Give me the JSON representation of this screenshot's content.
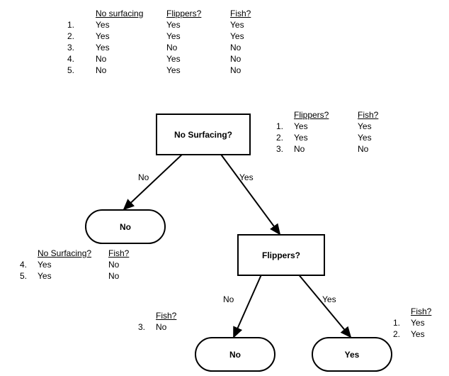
{
  "main_table": {
    "headers": [
      "",
      "No surfacing",
      "Flippers?",
      "Fish?"
    ],
    "rows": [
      [
        "1.",
        "Yes",
        "Yes",
        "Yes"
      ],
      [
        "2.",
        "Yes",
        "Yes",
        "Yes"
      ],
      [
        "3.",
        "Yes",
        "No",
        "No"
      ],
      [
        "4.",
        "No",
        "Yes",
        "No"
      ],
      [
        "5.",
        "No",
        "Yes",
        "No"
      ]
    ]
  },
  "node_root": {
    "label": "No Surfacing?"
  },
  "node_flippers": {
    "label": "Flippers?"
  },
  "term_no_top": {
    "label": "No"
  },
  "term_no_bot": {
    "label": "No"
  },
  "term_yes_bot": {
    "label": "Yes"
  },
  "edges": {
    "root_left": "No",
    "root_right": "Yes",
    "flip_left": "No",
    "flip_right": "Yes"
  },
  "side_right_top": {
    "headers": [
      "",
      "Flippers?",
      "Fish?"
    ],
    "rows": [
      [
        "1.",
        "Yes",
        "Yes"
      ],
      [
        "2.",
        "Yes",
        "Yes"
      ],
      [
        "3.",
        "No",
        "No"
      ]
    ]
  },
  "side_left_mid": {
    "headers": [
      "",
      "No Surfacing?",
      "Fish?"
    ],
    "rows": [
      [
        "4.",
        "Yes",
        "No"
      ],
      [
        "5.",
        "Yes",
        "No"
      ]
    ]
  },
  "side_bot_left": {
    "headers": [
      "",
      "Fish?"
    ],
    "rows": [
      [
        "3.",
        "No"
      ]
    ]
  },
  "side_bot_right": {
    "headers": [
      "",
      "Fish?"
    ],
    "rows": [
      [
        "1.",
        "Yes"
      ],
      [
        "2.",
        "Yes"
      ]
    ]
  },
  "chart_data": {
    "type": "table",
    "description": "Decision tree on attributes No Surfacing? and Flippers? predicting Fish?",
    "training_data": [
      {
        "id": 1,
        "no_surfacing": "Yes",
        "flippers": "Yes",
        "fish": "Yes"
      },
      {
        "id": 2,
        "no_surfacing": "Yes",
        "flippers": "Yes",
        "fish": "Yes"
      },
      {
        "id": 3,
        "no_surfacing": "Yes",
        "flippers": "No",
        "fish": "No"
      },
      {
        "id": 4,
        "no_surfacing": "No",
        "flippers": "Yes",
        "fish": "No"
      },
      {
        "id": 5,
        "no_surfacing": "No",
        "flippers": "Yes",
        "fish": "No"
      }
    ],
    "tree": {
      "attribute": "No Surfacing?",
      "branches": {
        "No": {
          "leaf": "No",
          "covers": [
            4,
            5
          ]
        },
        "Yes": {
          "attribute": "Flippers?",
          "branches": {
            "No": {
              "leaf": "No",
              "covers": [
                3
              ]
            },
            "Yes": {
              "leaf": "Yes",
              "covers": [
                1,
                2
              ]
            }
          }
        }
      }
    }
  }
}
